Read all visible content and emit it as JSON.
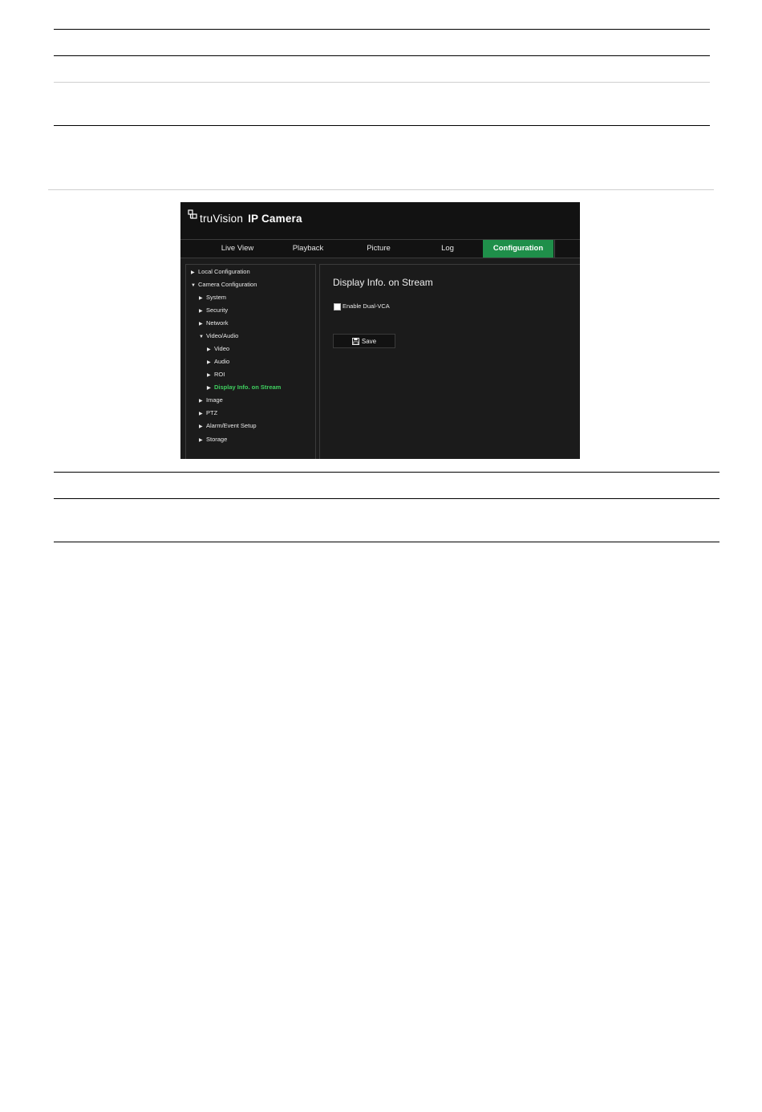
{
  "app": {
    "brand": "truVision",
    "product": "IP Camera"
  },
  "nav": {
    "tabs": [
      {
        "label": "Live View"
      },
      {
        "label": "Playback"
      },
      {
        "label": "Picture"
      },
      {
        "label": "Log"
      },
      {
        "label": "Configuration",
        "active": true
      }
    ]
  },
  "sidebar": {
    "items": [
      {
        "label": "Local Configuration",
        "expanded": false
      },
      {
        "label": "Camera Configuration",
        "expanded": true
      },
      {
        "label": "System",
        "expanded": false
      },
      {
        "label": "Security",
        "expanded": false
      },
      {
        "label": "Network",
        "expanded": false
      },
      {
        "label": "Video/Audio",
        "expanded": true
      },
      {
        "label": "Video",
        "expanded": false
      },
      {
        "label": "Audio",
        "expanded": false
      },
      {
        "label": "ROI",
        "expanded": false
      },
      {
        "label": "Display Info. on Stream",
        "expanded": false,
        "selected": true
      },
      {
        "label": "Image",
        "expanded": false
      },
      {
        "label": "PTZ",
        "expanded": false
      },
      {
        "label": "Alarm/Event Setup",
        "expanded": false
      },
      {
        "label": "Storage",
        "expanded": false
      }
    ]
  },
  "main": {
    "title": "Display Info. on Stream",
    "enable_dual_vca": {
      "label": "Enable Dual-VCA",
      "checked": false
    },
    "save_label": "Save"
  },
  "colors": {
    "accent": "#1f8f4a",
    "selected_text": "#3fcf5f",
    "background": "#1b1b1b",
    "header": "#121212"
  },
  "icons": [
    "logo-icon",
    "caret-right-icon",
    "caret-down-icon",
    "floppy-disk-icon"
  ]
}
